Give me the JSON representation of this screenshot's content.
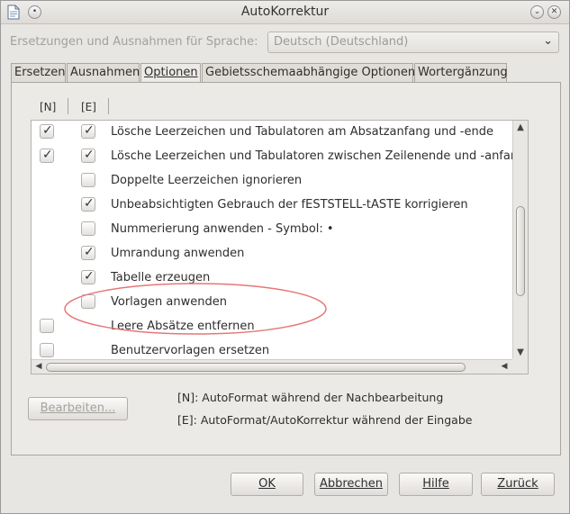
{
  "window": {
    "title": "AutoKorrektur",
    "minimize_icon": "chevron-down-icon",
    "close_icon": "close-icon"
  },
  "language": {
    "label": "Ersetzungen und Ausnahmen für Sprache:",
    "selected": "Deutsch (Deutschland)"
  },
  "tabs": [
    {
      "label": "Ersetzen",
      "active": false
    },
    {
      "label": "Ausnahmen",
      "active": false
    },
    {
      "label": "Optionen",
      "active": true
    },
    {
      "label": "Gebietsschemaabhängige Optionen",
      "active": false
    },
    {
      "label": "Wortergänzung",
      "active": false
    }
  ],
  "columns": {
    "n": "[N]",
    "e": "[E]"
  },
  "options": [
    {
      "label": "Lösche Leerzeichen und Tabulatoren am Absatzanfang und -ende",
      "n": "checked",
      "e": "checked"
    },
    {
      "label": "Lösche Leerzeichen und Tabulatoren zwischen Zeilenende und -anfang",
      "n": "checked",
      "e": "checked"
    },
    {
      "label": "Doppelte Leerzeichen ignorieren",
      "n": "none",
      "e": "unchecked"
    },
    {
      "label": "Unbeabsichtigten Gebrauch der fESTSTELL-tASTE korrigieren",
      "n": "none",
      "e": "checked"
    },
    {
      "label": "Nummerierung anwenden - Symbol: •",
      "n": "none",
      "e": "unchecked"
    },
    {
      "label": "Umrandung anwenden",
      "n": "none",
      "e": "checked"
    },
    {
      "label": "Tabelle erzeugen",
      "n": "none",
      "e": "checked"
    },
    {
      "label": "Vorlagen anwenden",
      "n": "none",
      "e": "unchecked"
    },
    {
      "label": "Leere Absätze entfernen",
      "n": "unchecked",
      "e": "none"
    },
    {
      "label": "Benutzervorlagen ersetzen",
      "n": "unchecked",
      "e": "none"
    }
  ],
  "edit_button": "Bearbeiten...",
  "legend": {
    "n": "[N]: AutoFormat während der Nachbearbeitung",
    "e": "[E]: AutoFormat/AutoKorrektur während der Eingabe"
  },
  "footer": {
    "ok": "OK",
    "cancel": "Abbrechen",
    "help": "Hilfe",
    "back": "Zurück"
  },
  "colors": {
    "highlight_ellipse": "#e57777",
    "panel_bg": "#eceae7",
    "list_bg": "#ffffff"
  }
}
